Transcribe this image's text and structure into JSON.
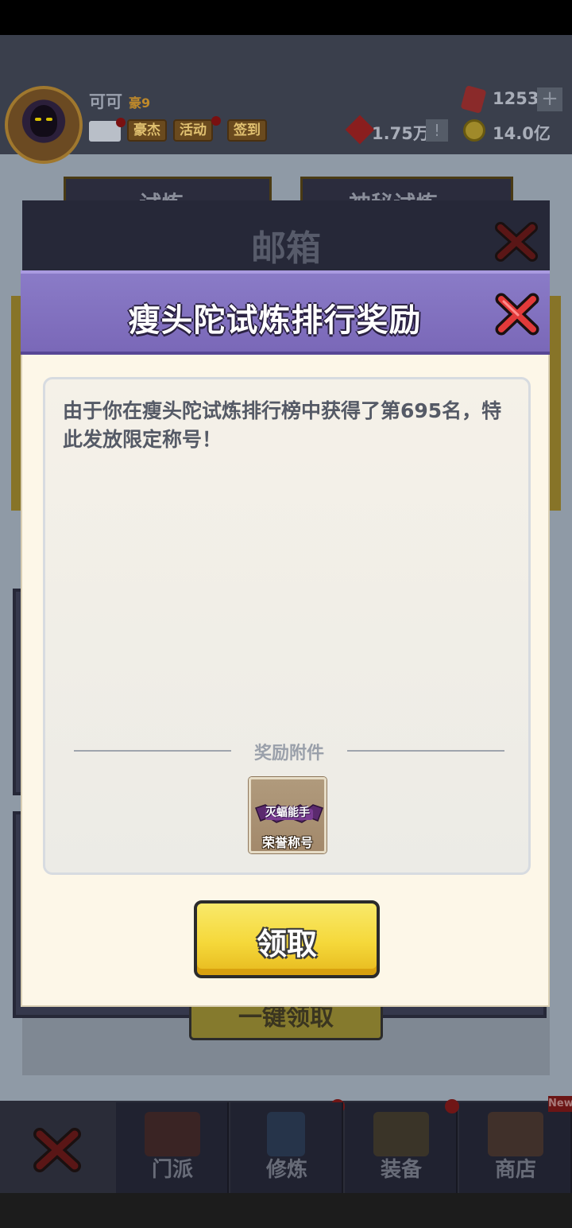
{
  "background": {
    "player": {
      "name": "可可",
      "vip": "豪9"
    },
    "hud_buttons": [
      "豪杰",
      "活动",
      "签到"
    ],
    "resources": {
      "gems": "1253",
      "tickets": "1.75万",
      "coins": "14.0亿"
    },
    "tabs": [
      "试炼",
      "神秘试炼"
    ],
    "mail_title": "邮箱",
    "one_key_label": "一键领取",
    "nav": [
      {
        "label": "门派",
        "icon": "temple-icon",
        "badge": true
      },
      {
        "label": "修炼",
        "icon": "book-icon",
        "badge": false
      },
      {
        "label": "装备",
        "icon": "sword-icon",
        "badge": true
      },
      {
        "label": "商店",
        "icon": "shop-icon",
        "badge": false
      }
    ],
    "new_badge": "New"
  },
  "dialog": {
    "title": "瘦头陀试炼排行奖励",
    "message": "由于你在瘦头陀试炼排行榜中获得了第695名，特此发放限定称号！",
    "attachments_label": "奖励附件",
    "reward": {
      "name": "灭蝠能手",
      "caption": "荣誉称号"
    },
    "claim_label": "领取"
  },
  "colors": {
    "header_purple": "#7a68b8",
    "dialog_bg": "#fdf7e8",
    "button_yellow": "#f5d83a"
  }
}
